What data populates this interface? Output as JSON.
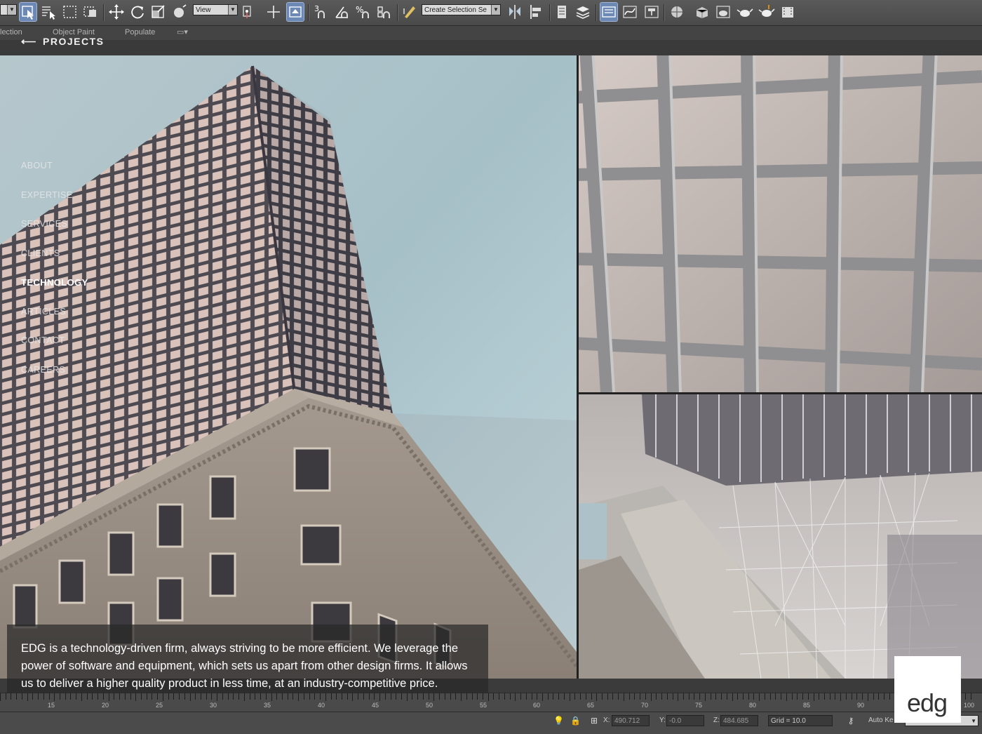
{
  "toolbar": {
    "view_dropdown": "View",
    "selection_set_dropdown": "Create Selection Se",
    "snap_labels": [
      "3",
      "%"
    ]
  },
  "ribbon": {
    "tabs": [
      "lection",
      "Object Paint",
      "Populate"
    ]
  },
  "header": {
    "back_label": "PROJECTS"
  },
  "nav": {
    "items": [
      "ABOUT",
      "EXPERTISE",
      "SERVICES",
      "CLIENTS",
      "TECHNOLOGY",
      "ARTICLES",
      "CONTACT",
      "CAREERS"
    ],
    "current": "TECHNOLOGY"
  },
  "description": "EDG is a technology-driven firm, always striving to be more efficient. We leverage the power of software and equipment, which sets us apart from other design firms. It allows us to deliver a higher quality product in less time, at an industry-competitive price.",
  "logo": {
    "text": "edg"
  },
  "timeline": {
    "labels": [
      "15",
      "20",
      "25",
      "30",
      "35",
      "40",
      "45",
      "50",
      "55",
      "60",
      "65",
      "70",
      "75",
      "80",
      "85",
      "90",
      "100"
    ]
  },
  "statusbar": {
    "x_label": "X:",
    "x_value": "490.712",
    "y_label": "Y:",
    "y_value": "-0.0",
    "z_label": "Z:",
    "z_value": "484.685",
    "grid": "Grid = 10.0",
    "auto_key": "Auto Ke"
  },
  "colors": {
    "sky": "#a9c3cb",
    "facade": "#9a8e84",
    "toolbar_active": "#6c88b4"
  }
}
